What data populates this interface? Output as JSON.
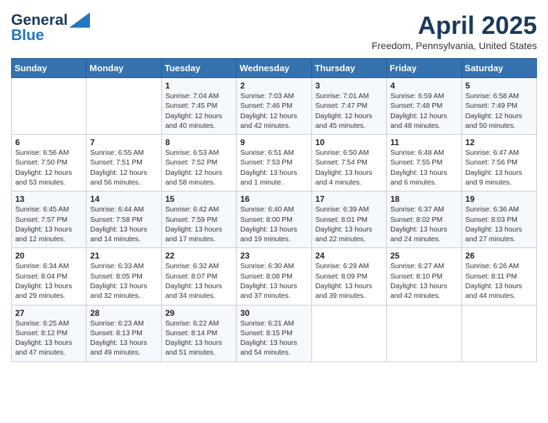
{
  "header": {
    "logo_line1": "General",
    "logo_line2": "Blue",
    "month_year": "April 2025",
    "location": "Freedom, Pennsylvania, United States"
  },
  "days_of_week": [
    "Sunday",
    "Monday",
    "Tuesday",
    "Wednesday",
    "Thursday",
    "Friday",
    "Saturday"
  ],
  "weeks": [
    [
      {
        "num": "",
        "sunrise": "",
        "sunset": "",
        "daylight": ""
      },
      {
        "num": "",
        "sunrise": "",
        "sunset": "",
        "daylight": ""
      },
      {
        "num": "1",
        "sunrise": "Sunrise: 7:04 AM",
        "sunset": "Sunset: 7:45 PM",
        "daylight": "Daylight: 12 hours and 40 minutes."
      },
      {
        "num": "2",
        "sunrise": "Sunrise: 7:03 AM",
        "sunset": "Sunset: 7:46 PM",
        "daylight": "Daylight: 12 hours and 42 minutes."
      },
      {
        "num": "3",
        "sunrise": "Sunrise: 7:01 AM",
        "sunset": "Sunset: 7:47 PM",
        "daylight": "Daylight: 12 hours and 45 minutes."
      },
      {
        "num": "4",
        "sunrise": "Sunrise: 6:59 AM",
        "sunset": "Sunset: 7:48 PM",
        "daylight": "Daylight: 12 hours and 48 minutes."
      },
      {
        "num": "5",
        "sunrise": "Sunrise: 6:58 AM",
        "sunset": "Sunset: 7:49 PM",
        "daylight": "Daylight: 12 hours and 50 minutes."
      }
    ],
    [
      {
        "num": "6",
        "sunrise": "Sunrise: 6:56 AM",
        "sunset": "Sunset: 7:50 PM",
        "daylight": "Daylight: 12 hours and 53 minutes."
      },
      {
        "num": "7",
        "sunrise": "Sunrise: 6:55 AM",
        "sunset": "Sunset: 7:51 PM",
        "daylight": "Daylight: 12 hours and 56 minutes."
      },
      {
        "num": "8",
        "sunrise": "Sunrise: 6:53 AM",
        "sunset": "Sunset: 7:52 PM",
        "daylight": "Daylight: 12 hours and 58 minutes."
      },
      {
        "num": "9",
        "sunrise": "Sunrise: 6:51 AM",
        "sunset": "Sunset: 7:53 PM",
        "daylight": "Daylight: 13 hours and 1 minute."
      },
      {
        "num": "10",
        "sunrise": "Sunrise: 6:50 AM",
        "sunset": "Sunset: 7:54 PM",
        "daylight": "Daylight: 13 hours and 4 minutes."
      },
      {
        "num": "11",
        "sunrise": "Sunrise: 6:48 AM",
        "sunset": "Sunset: 7:55 PM",
        "daylight": "Daylight: 13 hours and 6 minutes."
      },
      {
        "num": "12",
        "sunrise": "Sunrise: 6:47 AM",
        "sunset": "Sunset: 7:56 PM",
        "daylight": "Daylight: 13 hours and 9 minutes."
      }
    ],
    [
      {
        "num": "13",
        "sunrise": "Sunrise: 6:45 AM",
        "sunset": "Sunset: 7:57 PM",
        "daylight": "Daylight: 13 hours and 12 minutes."
      },
      {
        "num": "14",
        "sunrise": "Sunrise: 6:44 AM",
        "sunset": "Sunset: 7:58 PM",
        "daylight": "Daylight: 13 hours and 14 minutes."
      },
      {
        "num": "15",
        "sunrise": "Sunrise: 6:42 AM",
        "sunset": "Sunset: 7:59 PM",
        "daylight": "Daylight: 13 hours and 17 minutes."
      },
      {
        "num": "16",
        "sunrise": "Sunrise: 6:40 AM",
        "sunset": "Sunset: 8:00 PM",
        "daylight": "Daylight: 13 hours and 19 minutes."
      },
      {
        "num": "17",
        "sunrise": "Sunrise: 6:39 AM",
        "sunset": "Sunset: 8:01 PM",
        "daylight": "Daylight: 13 hours and 22 minutes."
      },
      {
        "num": "18",
        "sunrise": "Sunrise: 6:37 AM",
        "sunset": "Sunset: 8:02 PM",
        "daylight": "Daylight: 13 hours and 24 minutes."
      },
      {
        "num": "19",
        "sunrise": "Sunrise: 6:36 AM",
        "sunset": "Sunset: 8:03 PM",
        "daylight": "Daylight: 13 hours and 27 minutes."
      }
    ],
    [
      {
        "num": "20",
        "sunrise": "Sunrise: 6:34 AM",
        "sunset": "Sunset: 8:04 PM",
        "daylight": "Daylight: 13 hours and 29 minutes."
      },
      {
        "num": "21",
        "sunrise": "Sunrise: 6:33 AM",
        "sunset": "Sunset: 8:05 PM",
        "daylight": "Daylight: 13 hours and 32 minutes."
      },
      {
        "num": "22",
        "sunrise": "Sunrise: 6:32 AM",
        "sunset": "Sunset: 8:07 PM",
        "daylight": "Daylight: 13 hours and 34 minutes."
      },
      {
        "num": "23",
        "sunrise": "Sunrise: 6:30 AM",
        "sunset": "Sunset: 8:08 PM",
        "daylight": "Daylight: 13 hours and 37 minutes."
      },
      {
        "num": "24",
        "sunrise": "Sunrise: 6:29 AM",
        "sunset": "Sunset: 8:09 PM",
        "daylight": "Daylight: 13 hours and 39 minutes."
      },
      {
        "num": "25",
        "sunrise": "Sunrise: 6:27 AM",
        "sunset": "Sunset: 8:10 PM",
        "daylight": "Daylight: 13 hours and 42 minutes."
      },
      {
        "num": "26",
        "sunrise": "Sunrise: 6:26 AM",
        "sunset": "Sunset: 8:11 PM",
        "daylight": "Daylight: 13 hours and 44 minutes."
      }
    ],
    [
      {
        "num": "27",
        "sunrise": "Sunrise: 6:25 AM",
        "sunset": "Sunset: 8:12 PM",
        "daylight": "Daylight: 13 hours and 47 minutes."
      },
      {
        "num": "28",
        "sunrise": "Sunrise: 6:23 AM",
        "sunset": "Sunset: 8:13 PM",
        "daylight": "Daylight: 13 hours and 49 minutes."
      },
      {
        "num": "29",
        "sunrise": "Sunrise: 6:22 AM",
        "sunset": "Sunset: 8:14 PM",
        "daylight": "Daylight: 13 hours and 51 minutes."
      },
      {
        "num": "30",
        "sunrise": "Sunrise: 6:21 AM",
        "sunset": "Sunset: 8:15 PM",
        "daylight": "Daylight: 13 hours and 54 minutes."
      },
      {
        "num": "",
        "sunrise": "",
        "sunset": "",
        "daylight": ""
      },
      {
        "num": "",
        "sunrise": "",
        "sunset": "",
        "daylight": ""
      },
      {
        "num": "",
        "sunrise": "",
        "sunset": "",
        "daylight": ""
      }
    ]
  ]
}
